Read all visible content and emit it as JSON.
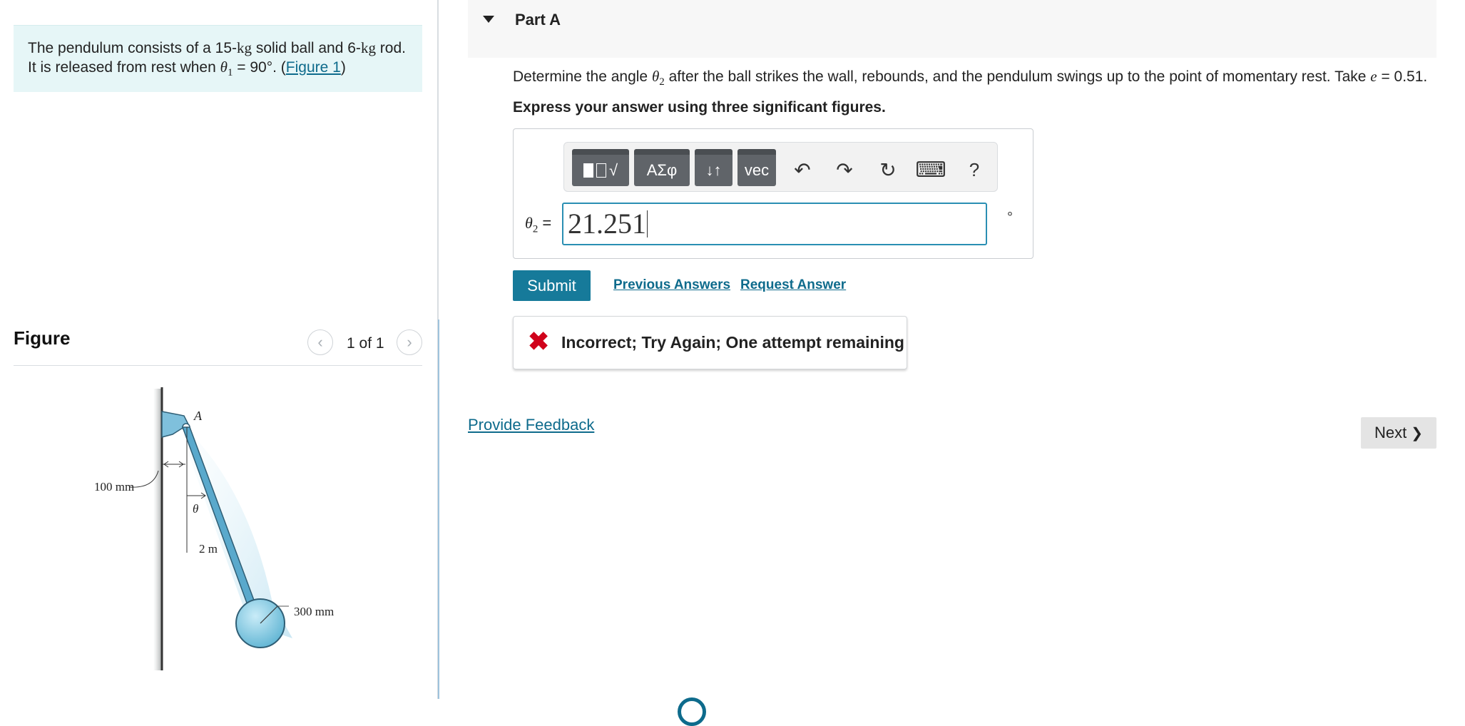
{
  "problem": {
    "text_1": "The pendulum consists of a 15-",
    "unit_kg_1": "kg",
    "text_2": " solid ball and 6-",
    "unit_kg_2": "kg",
    "text_3": " rod.",
    "text_4": "It is released from rest when ",
    "theta1_symbol": "θ",
    "theta1_sub": "1",
    "text_5": " = 90°. (",
    "figure_link": "Figure 1",
    "text_6": ")"
  },
  "figure_panel": {
    "title": "Figure",
    "counter": "1 of 1",
    "prev_glyph": "‹",
    "next_glyph": "›",
    "labels": {
      "pivot": "A",
      "offset": "100 mm",
      "angle": "θ",
      "rod_length": "2 m",
      "ball_radius": "300 mm"
    }
  },
  "part": {
    "title": "Part A",
    "question_pre": "Determine the angle ",
    "theta2_symbol": "θ",
    "theta2_sub": "2",
    "question_post": " after the ball strikes the wall, rebounds, and the pendulum swings up to the point of momentary rest. Take ",
    "e_symbol": "e",
    "question_end": " = 0.51.",
    "instruction": "Express your answer using three significant figures."
  },
  "toolbar": {
    "templates_label": "√",
    "greek_label": "ΑΣφ",
    "arrows_label": "↓↑",
    "vec_label": "vec",
    "undo_glyph": "↶",
    "redo_glyph": "↷",
    "reset_glyph": "↻",
    "keyboard_glyph": "⌨",
    "help_glyph": "?"
  },
  "answer": {
    "var_symbol": "θ",
    "var_sub": "2",
    "equals": " =",
    "value": "21.251",
    "unit": "°"
  },
  "actions": {
    "submit": "Submit",
    "previous_answers": "Previous Answers",
    "request_answer": "Request Answer"
  },
  "feedback": {
    "icon": "✖",
    "message": "Incorrect; Try Again; One attempt remaining"
  },
  "footer": {
    "provide_feedback": "Provide Feedback",
    "next": "Next",
    "next_chevron": "❯"
  },
  "colors": {
    "accent": "#167a9a",
    "link": "#0e6b8c",
    "error": "#d0021b",
    "problem_bg": "#e6f6f7"
  }
}
